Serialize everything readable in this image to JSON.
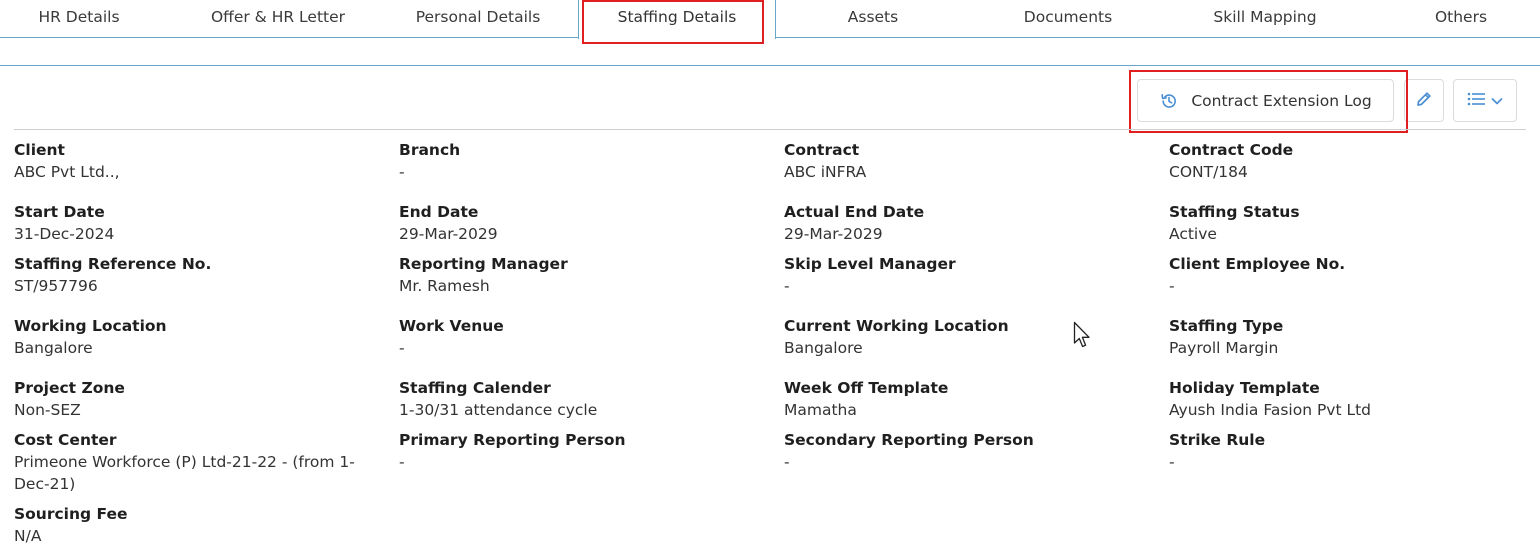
{
  "tabs": [
    {
      "label": "HR Details"
    },
    {
      "label": "Offer & HR Letter"
    },
    {
      "label": "Personal Details"
    },
    {
      "label": "Staffing Details"
    },
    {
      "label": "Assets"
    },
    {
      "label": "Documents"
    },
    {
      "label": "Skill Mapping"
    },
    {
      "label": "Others"
    }
  ],
  "active_tab": "Staffing Details",
  "toolbar": {
    "contract_log_label": "Contract Extension Log",
    "contract_log_icon": "history-icon",
    "edit_icon": "pencil-icon",
    "menu_icon": "list-icon",
    "menu_chevron_icon": "chevron-down-icon"
  },
  "fields": {
    "client": {
      "label": "Client",
      "value": "ABC Pvt Ltd..,"
    },
    "branch": {
      "label": "Branch",
      "value": "-"
    },
    "contract": {
      "label": "Contract",
      "value": "ABC iNFRA"
    },
    "contract_code": {
      "label": "Contract Code",
      "value": "CONT/184"
    },
    "start_date": {
      "label": "Start Date",
      "value": "31-Dec-2024"
    },
    "end_date": {
      "label": "End Date",
      "value": "29-Mar-2029"
    },
    "actual_end_date": {
      "label": "Actual End Date",
      "value": "29-Mar-2029"
    },
    "staffing_status": {
      "label": "Staffing Status",
      "value": "Active"
    },
    "staffing_reference_no": {
      "label": "Staffing Reference No.",
      "value": "ST/957796"
    },
    "reporting_manager": {
      "label": "Reporting Manager",
      "value": "Mr. Ramesh"
    },
    "skip_level_manager": {
      "label": "Skip Level Manager",
      "value": "-"
    },
    "client_employee_no": {
      "label": "Client Employee No.",
      "value": "-"
    },
    "working_location": {
      "label": "Working Location",
      "value": "Bangalore"
    },
    "work_venue": {
      "label": "Work Venue",
      "value": "-"
    },
    "current_working_location": {
      "label": "Current Working Location",
      "value": "Bangalore"
    },
    "staffing_type": {
      "label": "Staffing Type",
      "value": "Payroll Margin"
    },
    "project_zone": {
      "label": "Project Zone",
      "value": "Non-SEZ"
    },
    "staffing_calender": {
      "label": "Staffing Calender",
      "value": "1-30/31 attendance cycle"
    },
    "week_off_template": {
      "label": "Week Off Template",
      "value": "Mamatha"
    },
    "holiday_template": {
      "label": "Holiday Template",
      "value": "Ayush India Fasion Pvt Ltd"
    },
    "cost_center": {
      "label": "Cost Center",
      "value": "Primeone Workforce (P) Ltd-21-22 - (from 1-Dec-21)"
    },
    "primary_reporting_person": {
      "label": "Primary Reporting Person",
      "value": "-"
    },
    "secondary_reporting_person": {
      "label": "Secondary Reporting Person",
      "value": "-"
    },
    "strike_rule": {
      "label": "Strike Rule",
      "value": "-"
    },
    "sourcing_fee": {
      "label": "Sourcing Fee",
      "value": "N/A"
    }
  },
  "colors": {
    "accent": "#4a8fd4",
    "border_blue": "#6aa6c8",
    "highlight_red": "#e02020"
  }
}
